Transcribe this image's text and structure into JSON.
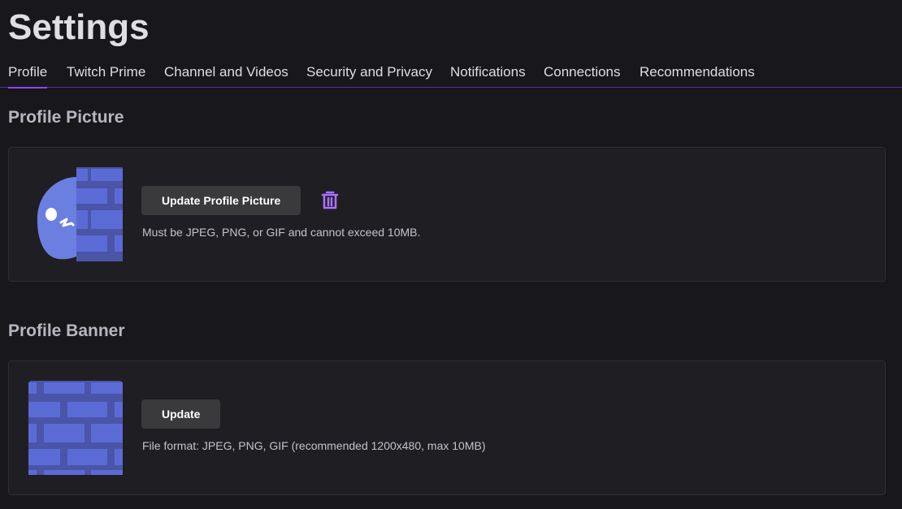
{
  "page_title": "Settings",
  "tabs": [
    {
      "label": "Profile",
      "active": true
    },
    {
      "label": "Twitch Prime",
      "active": false
    },
    {
      "label": "Channel and Videos",
      "active": false
    },
    {
      "label": "Security and Privacy",
      "active": false
    },
    {
      "label": "Notifications",
      "active": false
    },
    {
      "label": "Connections",
      "active": false
    },
    {
      "label": "Recommendations",
      "active": false
    }
  ],
  "profile_picture": {
    "heading": "Profile Picture",
    "update_label": "Update Profile Picture",
    "delete_icon": "trash-icon",
    "hint": "Must be JPEG, PNG, or GIF and cannot exceed 10MB."
  },
  "profile_banner": {
    "heading": "Profile Banner",
    "update_label": "Update",
    "hint": "File format: JPEG, PNG, GIF (recommended 1200x480, max 10MB)"
  },
  "colors": {
    "background": "#18171b",
    "card": "#1f1f23",
    "accent": "#9147ff",
    "avatar_blue": "#6b7fe0",
    "brick": "#5b6bd6"
  }
}
